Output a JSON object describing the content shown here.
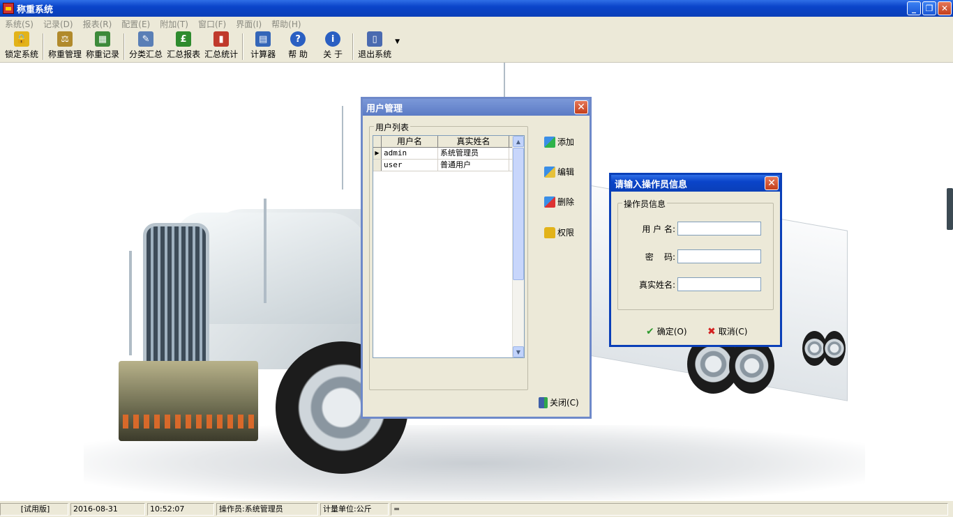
{
  "window": {
    "title": "称重系统",
    "minimize": "_",
    "restore": "❐",
    "close": "✕"
  },
  "menu": [
    "系统(S)",
    "记录(D)",
    "报表(R)",
    "配置(E)",
    "附加(T)",
    "窗口(F)",
    "界面(I)",
    "帮助(H)"
  ],
  "toolbar": [
    {
      "label": "锁定系统",
      "icon": "lock-icon",
      "color": "#e2b31a",
      "glyph": "🔒"
    },
    {
      "label": "称重管理",
      "icon": "scale-icon",
      "color": "#b18a2c",
      "glyph": "⚖"
    },
    {
      "label": "称重记录",
      "icon": "records-icon",
      "color": "#3d8a3a",
      "glyph": "▦"
    },
    {
      "label": "分类汇总",
      "icon": "category-summary-icon",
      "color": "#5a7fb6",
      "glyph": "✎"
    },
    {
      "label": "汇总报表",
      "icon": "summary-report-icon",
      "color": "#2e8b2e",
      "glyph": "£"
    },
    {
      "label": "汇总统计",
      "icon": "statistics-icon",
      "color": "#c0392b",
      "glyph": "▮"
    },
    {
      "label": "计算器",
      "icon": "calculator-icon",
      "color": "#3466b8",
      "glyph": "▤"
    },
    {
      "label": "帮 助",
      "icon": "help-icon",
      "color": "#2a5fc2",
      "glyph": "?"
    },
    {
      "label": "关 于",
      "icon": "about-icon",
      "color": "#2a5fc2",
      "glyph": "i"
    },
    {
      "label": "退出系统",
      "icon": "exit-icon",
      "color": "#4a6ab0",
      "glyph": "▯"
    }
  ],
  "user_mgmt": {
    "title": "用户管理",
    "group_label": "用户列表",
    "columns": [
      "用户名",
      "真实姓名"
    ],
    "rows": [
      {
        "username": "admin",
        "realname": "系统管理员"
      },
      {
        "username": "user",
        "realname": "普通用户"
      }
    ],
    "buttons": {
      "add": "添加",
      "edit": "编辑",
      "delete": "删除",
      "perm": "权限",
      "close": "关闭(C)"
    }
  },
  "operator_dialog": {
    "title": "请输入操作员信息",
    "group_label": "操作员信息",
    "fields": {
      "username_label": "用 户 名:",
      "password_label": "密    码:",
      "realname_label": "真实姓名:",
      "username_value": "",
      "password_value": "",
      "realname_value": ""
    },
    "ok": "确定(O)",
    "cancel": "取消(C)"
  },
  "status": {
    "edition": "[试用版]",
    "date": "2016-08-31",
    "time": "10:52:07",
    "operator": "操作员:系统管理员",
    "unit": "计量单位:公斤",
    "extra": "="
  }
}
